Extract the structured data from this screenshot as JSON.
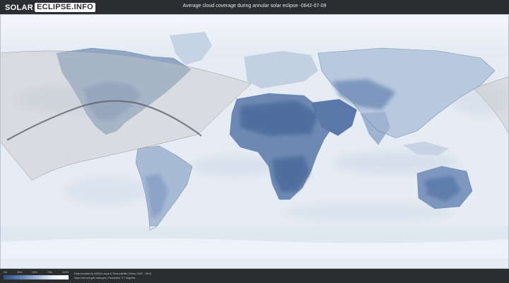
{
  "header": {
    "logo_left": "SOLAR",
    "logo_right": "ECLIPSE.INFO",
    "title": "Average cloud coverage during annular solar eclipse -0642-07-09"
  },
  "legend": {
    "ticks": [
      "0%",
      "25%",
      "50%",
      "75%",
      "100%"
    ],
    "colors": {
      "low": "#2f4f82",
      "mid": "#9db5d3",
      "high": "#ffffff"
    }
  },
  "credits": {
    "line1": "Data provided by NASA's Aqua & Terra satellite (Years: 2000 - 2019)",
    "line2": "https://neo.sci.gsfc.nasa.gov | Resolution: 0.7 degrees"
  },
  "map": {
    "projection": "equirectangular",
    "colors": {
      "ocean_cloud": "#e9eef4",
      "clear_sky": "#4f6e9e",
      "land_edge": "#6d86ad",
      "shadow_zone": "#cfcfcf",
      "central_path": "#5a5f66"
    }
  }
}
